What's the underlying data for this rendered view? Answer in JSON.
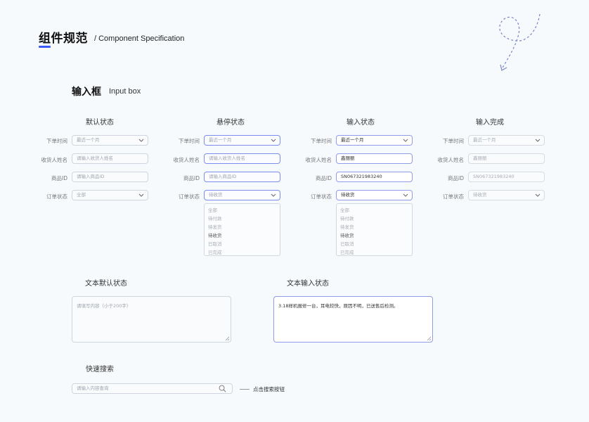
{
  "header": {
    "title": "组件规范",
    "subtitle": "/ Component Specification"
  },
  "section": {
    "title": "输入框",
    "subtitle": "Input box"
  },
  "labels": {
    "order_time": "下单时间",
    "receiver_name": "收货人姓名",
    "product_id": "商品ID",
    "order_status": "订单状态"
  },
  "columns": [
    {
      "title": "默认状态",
      "order_time": "最近一个月",
      "receiver_name": "请输入收货人姓名",
      "product_id": "请输入商品ID",
      "order_status": "全部"
    },
    {
      "title": "悬停状态",
      "order_time": "最近一个月",
      "receiver_name": "请输入收货人姓名",
      "product_id": "请输入商品ID",
      "order_status": "待收货"
    },
    {
      "title": "输入状态",
      "order_time": "最近一个月",
      "receiver_name": "鑫丽丽",
      "product_id": "SN067321983240",
      "order_status": "待收货"
    },
    {
      "title": "输入完成",
      "order_time": "最近一个月",
      "receiver_name": "鑫丽丽",
      "product_id": "SN067321983240",
      "order_status": "待收货"
    }
  ],
  "dropdown": {
    "options": [
      "全部",
      "待付款",
      "待发货",
      "待收货",
      "已取消",
      "已完成"
    ],
    "selected": "待收货"
  },
  "textareas": {
    "default_title": "文本默认状态",
    "default_placeholder": "请填写内容（小于200字）",
    "input_title": "文本输入状态",
    "input_value": "3.18样机报修一台，耳电较快，原因不明，已送售后检测。"
  },
  "search": {
    "title": "快速搜索",
    "placeholder": "请输入内容查询",
    "annotation": "点击搜索按钮"
  },
  "colors": {
    "accent": "#3d5cf5",
    "active_border": "#8f9cec",
    "background": "#f6fafd"
  }
}
